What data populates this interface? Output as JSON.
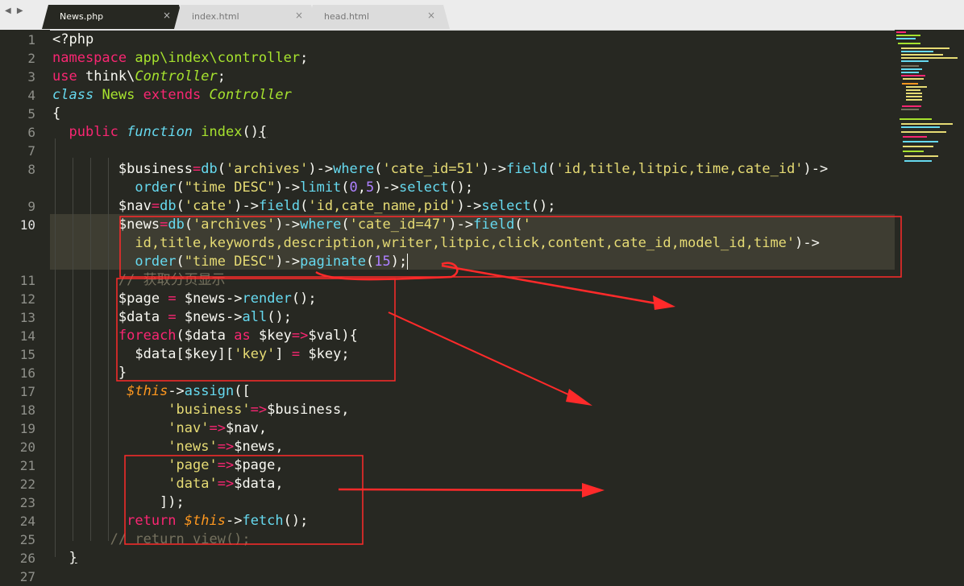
{
  "nav_arrows": "◀ ▶",
  "tabs": [
    {
      "label": "News.php",
      "active": true
    },
    {
      "label": "index.html",
      "active": false
    },
    {
      "label": "head.html",
      "active": false
    }
  ],
  "close_glyph": "×",
  "current_line": "10",
  "line_numbers": [
    "1",
    "2",
    "3",
    "4",
    "5",
    "6",
    "7",
    "8",
    "",
    "9",
    "10",
    "",
    "",
    "11",
    "12",
    "13",
    "14",
    "15",
    "16",
    "17",
    "18",
    "19",
    "20",
    "21",
    "22",
    "23",
    "24",
    "25",
    "26",
    "27"
  ],
  "tokens": {
    "open_tag": "<?php",
    "namespace_kw": "namespace",
    "namespace_val": "app\\index\\controller",
    "use_kw": "use",
    "use_ns": "think\\",
    "controller_cls": "Controller",
    "class_kw": "class",
    "class_name": "News",
    "extends_kw": "extends",
    "public_kw": "public",
    "function_kw": "function",
    "method_name": "index",
    "db_fn": "db",
    "where_fn": "where",
    "field_fn": "field",
    "order_fn": "order",
    "limit_fn": "limit",
    "select_fn": "select",
    "paginate_fn": "paginate",
    "render_fn": "render",
    "all_fn": "all",
    "foreach_kw": "foreach",
    "as_kw": "as",
    "return_kw": "return",
    "this_var": "$this",
    "assign_fn": "assign",
    "fetch_fn": "fetch",
    "var_business": "$business",
    "var_nav": "$nav",
    "var_news": "$news",
    "var_page": "$page",
    "var_data": "$data",
    "var_key": "$key",
    "var_val": "$val",
    "str_archives": "'archives'",
    "str_cate": "'cate'",
    "str_cate51": "'cate_id=51'",
    "str_cate47": "'cate_id=47'",
    "str_fields1": "'id,title,litpic,time,cate_id'",
    "str_fields2": "'id,cate_name,pid'",
    "str_fields3a": "'",
    "str_fields3b": "id,title,keywords,description,writer,litpic,click,content,cate_id,model_id,time'",
    "str_order": "\"time DESC\"",
    "str_key": "'key'",
    "str_business": "'business'",
    "str_nav": "'nav'",
    "str_news": "'news'",
    "str_page": "'page'",
    "str_data": "'data'",
    "num_0": "0",
    "num_5": "5",
    "num_15": "15",
    "comment_pagination": "// 获取分页显示",
    "comment_return_view": "// return view();"
  },
  "colors": {
    "background": "#272822",
    "keyword": "#f92672",
    "string": "#e6db74",
    "function": "#66d9ef",
    "class": "#a6e22e",
    "number": "#ae81ff",
    "this": "#fd971f",
    "comment": "#75715e",
    "annotation": "#ff2a2a"
  }
}
